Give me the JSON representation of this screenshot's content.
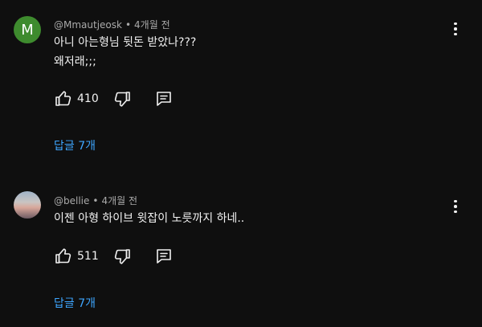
{
  "comments": [
    {
      "avatar_letter": "M",
      "author": "@Mmautjeosk",
      "time": "4개월 전",
      "lines": [
        "아니 아는형님 뒷돈 받았나???",
        "왜저래;;;"
      ],
      "likes": "410",
      "replies_label": "답글 7개"
    },
    {
      "avatar_letter": "",
      "author": "@bellie",
      "time": "4개월 전",
      "lines": [
        "이젠 아형 하이브 윗잡이 노릇까지 하네.."
      ],
      "likes": "511",
      "replies_label": "답글 7개"
    }
  ],
  "separator": "•",
  "colors": {
    "background": "#0f0f0f",
    "link": "#3ea6ff",
    "avatar_m": "#3e8b2e"
  },
  "icons": [
    "like-icon",
    "dislike-icon",
    "reply-icon",
    "more-vert-icon"
  ]
}
